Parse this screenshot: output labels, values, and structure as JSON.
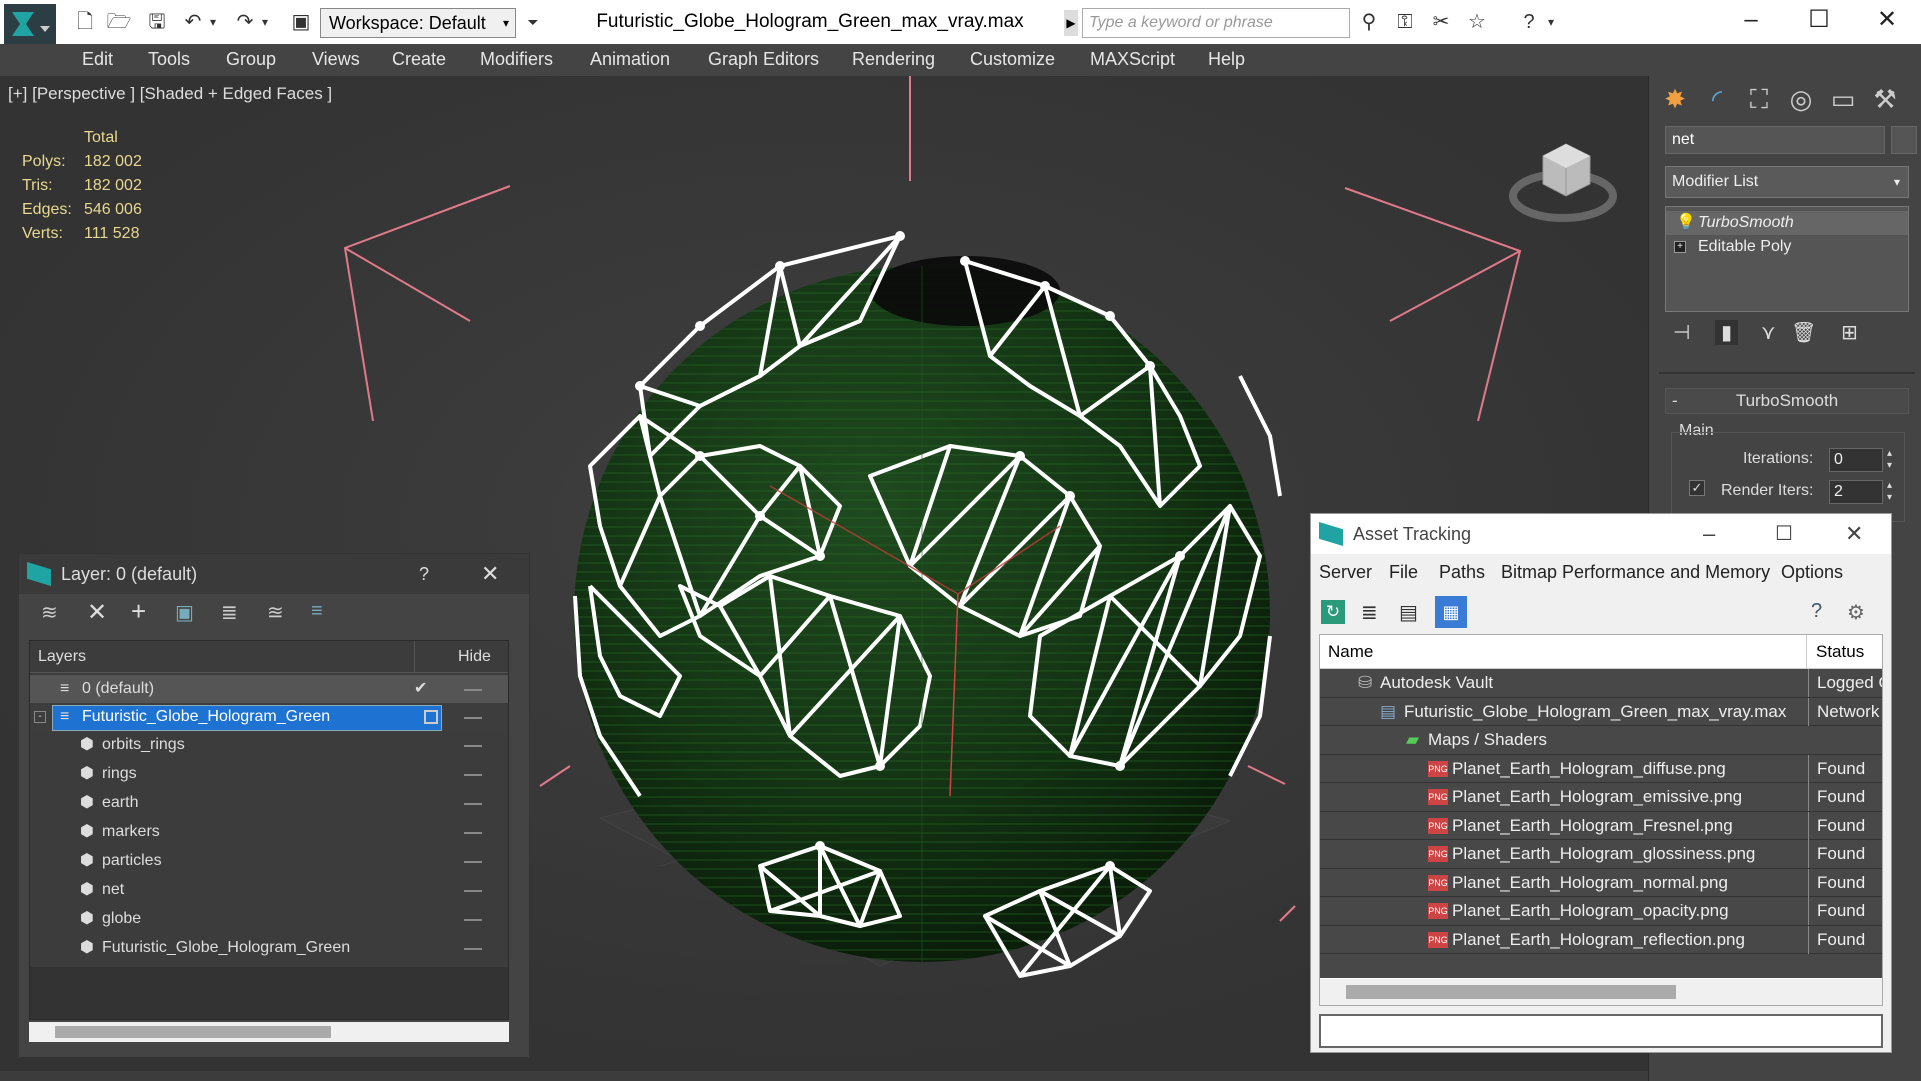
{
  "window": {
    "title": "Futuristic_Globe_Hologram_Green_max_vray.max",
    "workspace": "Workspace: Default",
    "search_placeholder": "Type a keyword or phrase"
  },
  "menu": [
    "Edit",
    "Tools",
    "Group",
    "Views",
    "Create",
    "Modifiers",
    "Animation",
    "Graph Editors",
    "Rendering",
    "Customize",
    "MAXScript",
    "Help"
  ],
  "viewport": {
    "label": "[+] [Perspective ] [Shaded + Edged Faces ]",
    "stats_header": "Total",
    "stats": [
      {
        "label": "Polys:",
        "value": "182 002"
      },
      {
        "label": "Tris:",
        "value": "182 002"
      },
      {
        "label": "Edges:",
        "value": "546 006"
      },
      {
        "label": "Verts:",
        "value": "111 528"
      }
    ]
  },
  "command_panel": {
    "object_name": "net",
    "modifier_list": "Modifier List",
    "stack": [
      "TurboSmooth",
      "Editable Poly"
    ],
    "rollout_title": "TurboSmooth",
    "group_main": "Main",
    "iterations_label": "Iterations:",
    "iterations_value": "0",
    "render_iters_label": "Render Iters:",
    "render_iters_value": "2"
  },
  "layer_window": {
    "title": "Layer: 0 (default)",
    "help": "?",
    "col_layers": "Layers",
    "col_hide": "Hide",
    "rows": [
      {
        "name": "0 (default)",
        "level": 0
      },
      {
        "name": "Futuristic_Globe_Hologram_Green",
        "level": 0
      },
      {
        "name": "orbits_rings",
        "level": 1
      },
      {
        "name": "rings",
        "level": 1
      },
      {
        "name": "earth",
        "level": 1
      },
      {
        "name": "markers",
        "level": 1
      },
      {
        "name": "particles",
        "level": 1
      },
      {
        "name": "net",
        "level": 1
      },
      {
        "name": "globe",
        "level": 1
      },
      {
        "name": "Futuristic_Globe_Hologram_Green",
        "level": 1
      }
    ]
  },
  "asset_window": {
    "title": "Asset Tracking",
    "menu": [
      "Server",
      "File",
      "Paths",
      "Bitmap Performance and Memory",
      "Options"
    ],
    "col_name": "Name",
    "col_status": "Status",
    "rows": [
      {
        "name": "Autodesk Vault",
        "status": "Logged O",
        "level": 0
      },
      {
        "name": "Futuristic_Globe_Hologram_Green_max_vray.max",
        "status": "Network F",
        "level": 1
      },
      {
        "name": "Maps / Shaders",
        "status": "",
        "level": 2
      },
      {
        "name": "Planet_Earth_Hologram_diffuse.png",
        "status": "Found",
        "level": 3
      },
      {
        "name": "Planet_Earth_Hologram_emissive.png",
        "status": "Found",
        "level": 3
      },
      {
        "name": "Planet_Earth_Hologram_Fresnel.png",
        "status": "Found",
        "level": 3
      },
      {
        "name": "Planet_Earth_Hologram_glossiness.png",
        "status": "Found",
        "level": 3
      },
      {
        "name": "Planet_Earth_Hologram_normal.png",
        "status": "Found",
        "level": 3
      },
      {
        "name": "Planet_Earth_Hologram_opacity.png",
        "status": "Found",
        "level": 3
      },
      {
        "name": "Planet_Earth_Hologram_reflection.png",
        "status": "Found",
        "level": 3
      }
    ]
  }
}
